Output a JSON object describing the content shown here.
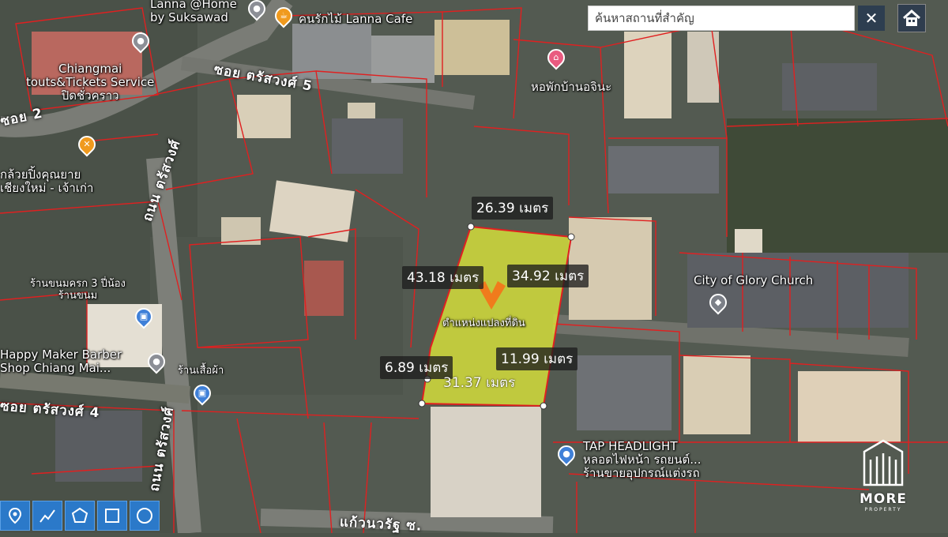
{
  "search": {
    "placeholder": "ค้นหาสถานที่สำคัญ",
    "close_label": "✕"
  },
  "pois": {
    "lanna_home": "Lanna @Home\nby Suksawad",
    "lanna_cafe": "คนรักไม้ Lanna Cafe",
    "chiangmai_tours": "Chiangmai\ntouts&Tickets Service\nปิดชั่วคราว",
    "hostel": "หอพักบ้านอจินะ",
    "restaurant": "กล้วยปิ้งคุณยาย\nเชียงใหม่ - เจ้าเก่า",
    "dessert": "ร้านขนมครก 3 ปี่น้อง\nร้านขนม",
    "barber": "Happy Maker Barber\nShop Chiang Mai...",
    "clothes": "ร้านเสื้อผ้า",
    "church": "City of Glory Church",
    "parcel_label": "ตำแหน่งแปลงที่ดิน",
    "tap": "TAP HEADLIGHT\nหลอดไฟหน้า รถยนต์...\nร้านขายอุปกรณ์แต่งรถ"
  },
  "roads": {
    "soi5": "ซอย ตรัสวงศ์ 5",
    "soi2": "ซอย 2",
    "thanon_upper": "ถนน ตรัสวงศ์",
    "soi4": "ซอย ตรัสวงศ์ 4",
    "thanon_lower": "ถนน ตรัสวงศ์",
    "kaewnawarat": "แก้วนวรัฐ ซ."
  },
  "dimensions": {
    "top": "26.39 เมตร",
    "left": "43.18 เมตร",
    "right": "34.92 เมตร",
    "lower_left": "6.89 เมตร",
    "lower_right": "11.99 เมตร",
    "bottom": "31.37 เมตร"
  },
  "brand": {
    "name": "MORE",
    "sub": "PROPERTY"
  },
  "colors": {
    "parcel_fill": "#d8e23a",
    "parcel_line": "#e02020",
    "tool_blue": "#2b79c9",
    "marker_orange": "#f07b1c"
  }
}
